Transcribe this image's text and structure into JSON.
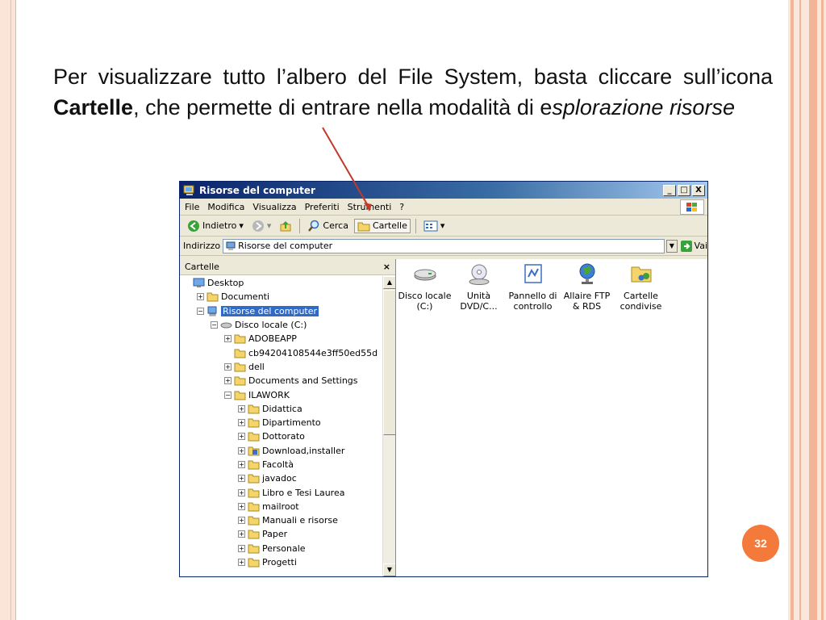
{
  "slide": {
    "text_part1": "Per visualizzare tutto l’albero del File System, basta cliccare sull’icona ",
    "text_bold": "Cartelle",
    "text_part2": ", che permette di entrare nella modalità di e",
    "text_italic": "splorazione risorse",
    "page_number": "32"
  },
  "window": {
    "title": "Risorse del computer",
    "controls": {
      "minimize": "_",
      "maximize": "□",
      "close": "X"
    },
    "menu": [
      {
        "label": "File",
        "key": "F"
      },
      {
        "label": "Modifica",
        "key": "M"
      },
      {
        "label": "Visualizza",
        "key": "V"
      },
      {
        "label": "Preferiti",
        "key": "P"
      },
      {
        "label": "Strumenti",
        "key": "S"
      },
      {
        "label": "?",
        "key": "?"
      }
    ],
    "toolbar": {
      "back_label": "Indietro",
      "search_label": "Cerca",
      "folders_label": "Cartelle"
    },
    "address": {
      "label": "Indirizzo",
      "value": "Risorse del computer",
      "go_label": "Vai"
    },
    "tree_pane": {
      "title": "Cartelle",
      "close": "×",
      "items": [
        {
          "label": "Desktop",
          "level": 0,
          "expander": "",
          "icon": "desktop-icon"
        },
        {
          "label": "Documenti",
          "level": 1,
          "expander": "+",
          "icon": "folder-icon"
        },
        {
          "label": "Risorse del computer",
          "level": 1,
          "expander": "−",
          "icon": "computer-icon",
          "selected": true
        },
        {
          "label": "Disco locale (C:)",
          "level": 2,
          "expander": "−",
          "icon": "drive-icon"
        },
        {
          "label": "ADOBEAPP",
          "level": 3,
          "expander": "+",
          "icon": "folder-icon"
        },
        {
          "label": "cb94204108544e3ff50ed55d",
          "level": 3,
          "expander": "",
          "icon": "folder-icon"
        },
        {
          "label": "dell",
          "level": 3,
          "expander": "+",
          "icon": "folder-icon"
        },
        {
          "label": "Documents and Settings",
          "level": 3,
          "expander": "+",
          "icon": "folder-icon"
        },
        {
          "label": "ILAWORK",
          "level": 3,
          "expander": "−",
          "icon": "folder-icon"
        },
        {
          "label": "Didattica",
          "level": 4,
          "expander": "+",
          "icon": "folder-icon"
        },
        {
          "label": "Dipartimento",
          "level": 4,
          "expander": "+",
          "icon": "folder-icon"
        },
        {
          "label": "Dottorato",
          "level": 4,
          "expander": "+",
          "icon": "folder-icon"
        },
        {
          "label": "Download,installer",
          "level": 4,
          "expander": "+",
          "icon": "installer-folder-icon"
        },
        {
          "label": "Facoltà",
          "level": 4,
          "expander": "+",
          "icon": "folder-icon"
        },
        {
          "label": "javadoc",
          "level": 4,
          "expander": "+",
          "icon": "folder-icon"
        },
        {
          "label": "Libro e Tesi Laurea",
          "level": 4,
          "expander": "+",
          "icon": "folder-icon"
        },
        {
          "label": "mailroot",
          "level": 4,
          "expander": "+",
          "icon": "folder-icon"
        },
        {
          "label": "Manuali e risorse",
          "level": 4,
          "expander": "+",
          "icon": "folder-icon"
        },
        {
          "label": "Paper",
          "level": 4,
          "expander": "+",
          "icon": "folder-icon"
        },
        {
          "label": "Personale",
          "level": 4,
          "expander": "+",
          "icon": "folder-icon"
        },
        {
          "label": "Progetti",
          "level": 4,
          "expander": "+",
          "icon": "folder-icon"
        }
      ]
    },
    "content_items": [
      {
        "label": "Disco locale (C:)",
        "icon": "hard-drive-icon"
      },
      {
        "label": "Unità DVD/C...",
        "icon": "dvd-drive-icon"
      },
      {
        "label": "Pannello di controllo",
        "icon": "control-panel-icon"
      },
      {
        "label": "Allaire FTP & RDS",
        "icon": "globe-icon"
      },
      {
        "label": "Cartelle condivise",
        "icon": "shared-folders-icon"
      }
    ],
    "colors": {
      "titlebar": "#0a246a",
      "selection": "#316ac5",
      "folder": "#f5d46a",
      "arrow": "#c0392b",
      "badge": "#f47a3c"
    }
  }
}
